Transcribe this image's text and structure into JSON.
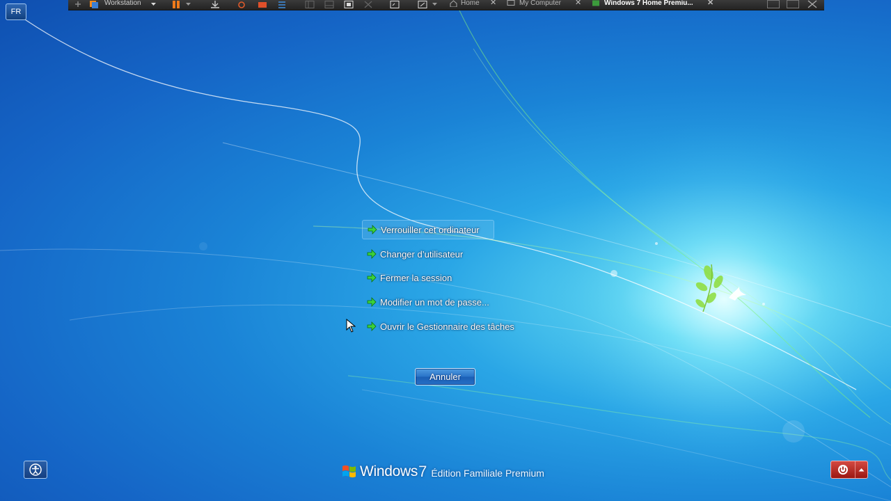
{
  "vm_toolbar": {
    "product_label": "Workstation",
    "tabs": [
      {
        "label": "Home",
        "active": false
      },
      {
        "label": "My Computer",
        "active": false
      },
      {
        "label": "Windows 7 Home Premiu...",
        "active": true
      }
    ],
    "close_glyph": "✕"
  },
  "language_indicator": "FR",
  "menu": {
    "items": [
      {
        "label": "Verrouiller cet ordinateur",
        "icon": "green-arrow-icon"
      },
      {
        "label": "Changer d’utilisateur",
        "icon": "green-arrow-icon"
      },
      {
        "label": "Fermer la session",
        "icon": "green-arrow-icon"
      },
      {
        "label": "Modifier un mot de passe...",
        "icon": "green-arrow-icon"
      },
      {
        "label": "Ouvrir le Gestionnaire des tâches",
        "icon": "green-arrow-icon"
      }
    ],
    "hovered_index": 0
  },
  "cancel_label": "Annuler",
  "branding": {
    "word": "Windows",
    "version": "7",
    "edition": "Édition Familiale Premium"
  },
  "colors": {
    "accent_green": "#3cd23c",
    "shutdown_red": "#b82a24",
    "button_blue": "#2a74c9"
  }
}
